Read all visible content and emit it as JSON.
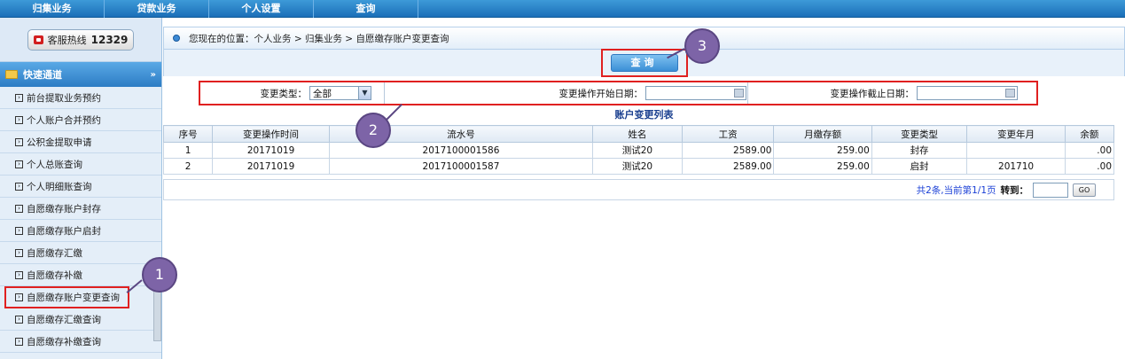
{
  "topnav": {
    "items": [
      "归集业务",
      "贷款业务",
      "个人设置",
      "查询"
    ]
  },
  "sidebar": {
    "hotline_label": "客服热线",
    "hotline_number": "12329",
    "section_title": "快速通道",
    "items": [
      "前台提取业务预约",
      "个人账户合并预约",
      "公积金提取申请",
      "个人总账查询",
      "个人明细账查询",
      "自愿缴存账户封存",
      "自愿缴存账户启封",
      "自愿缴存汇缴",
      "自愿缴存补缴",
      "自愿缴存账户变更查询",
      "自愿缴存汇缴查询",
      "自愿缴存补缴查询"
    ]
  },
  "breadcrumb": "您现在的位置：个人业务 > 归集业务 > 自愿缴存账户变更查询",
  "query_button": "查询",
  "filters": {
    "change_type_label": "变更类型：",
    "change_type_value": "全部",
    "start_date_label": "变更操作开始日期：",
    "end_date_label": "变更操作截止日期："
  },
  "table": {
    "title": "账户变更列表",
    "headers": [
      "序号",
      "变更操作时间",
      "流水号",
      "姓名",
      "工资",
      "月缴存额",
      "变更类型",
      "变更年月",
      "余额"
    ],
    "rows": [
      [
        "1",
        "20171019",
        "2017100001586",
        "测试20",
        "2589.00",
        "259.00",
        "封存",
        "",
        ".00"
      ],
      [
        "2",
        "20171019",
        "2017100001587",
        "测试20",
        "2589.00",
        "259.00",
        "启封",
        "201710",
        ".00"
      ]
    ]
  },
  "pager": {
    "info": "共2条,当前第1/1页",
    "goto_label": "转到：",
    "go_button": "GO"
  },
  "callouts": [
    "1",
    "2",
    "3"
  ]
}
